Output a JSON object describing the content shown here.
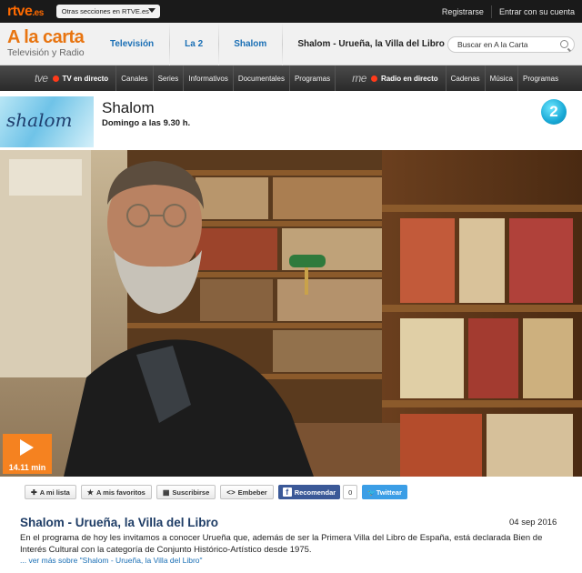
{
  "topbar": {
    "logo": "rtve",
    "logo_suffix": ".es",
    "sections_label": "Otras secciones en RTVE.es",
    "links": [
      "Registrarse",
      "Entrar con su cuenta"
    ]
  },
  "header": {
    "brand_title": "A la carta",
    "brand_subtitle": "Televisión y Radio",
    "breadcrumbs": [
      {
        "label": "Televisión"
      },
      {
        "label": "La 2"
      },
      {
        "label": "Shalom"
      },
      {
        "label": "Shalom - Urueña, la Villa del Libro"
      }
    ],
    "search_placeholder": "Buscar en A la Carta"
  },
  "navbar": {
    "tv_logo": "tve",
    "tv_label": "TV en directo",
    "tv_items": [
      "Canales",
      "Series",
      "Informativos",
      "Documentales",
      "Programas"
    ],
    "radio_logo": "rne",
    "radio_label": "Radio en directo",
    "radio_items": [
      "Cadenas",
      "Música",
      "Programas"
    ]
  },
  "program": {
    "thumb_text": "shalom",
    "title": "Shalom",
    "schedule": "Domingo a las 9.30 h.",
    "channel_badge": "2"
  },
  "video": {
    "duration": "14.11 min"
  },
  "share": {
    "my_list": "A mi lista",
    "favorites": "A mis favoritos",
    "subscribe": "Suscribirse",
    "embed": "Embeber",
    "facebook": "Recomendar",
    "facebook_count": "0",
    "twitter": "Twittear"
  },
  "episode": {
    "title": "Shalom - Urueña, la Villa del Libro",
    "date": "04 sep 2016",
    "description": "En el programa de hoy les invitamos a conocer Urueña que, además de ser la Primera Villa del Libro de España, está declarada Bien de Interés Cultural con la categoría de Conjunto Histórico-Artístico desde 1975.",
    "more_prefix": "... ",
    "more_link": "ver más sobre \"Shalom - Urueña, la Villa del Libro\""
  },
  "colors": {
    "accent_orange": "#f58220",
    "link_blue": "#1a6fb5",
    "title_navy": "#1f3d66",
    "channel_cyan": "#19a9d6"
  }
}
